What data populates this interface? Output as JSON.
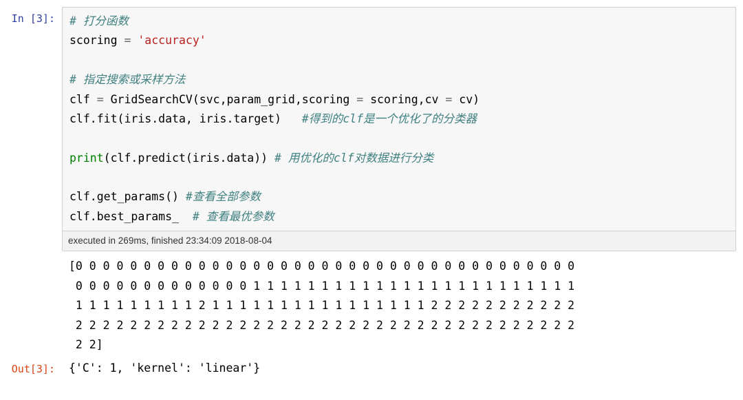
{
  "in_prompt": "In  [3]:",
  "out_prompt": "Out[3]:",
  "code": {
    "l1_comment": "# 打分函数",
    "l2_pre": "scoring ",
    "l2_op": "=",
    "l2_str": " 'accuracy'",
    "l3": "",
    "l4_comment": "# 指定搜索或采样方法",
    "l5_pre": "clf ",
    "l5_op": "=",
    "l5_post": " GridSearchCV(svc,param_grid,scoring ",
    "l5_op2": "=",
    "l5_post2": " scoring,cv ",
    "l5_op3": "=",
    "l5_post3": " cv)",
    "l6_pre": "clf.fit(iris.data, iris.target)   ",
    "l6_comment": "#得到的clf是一个优化了的分类器",
    "l7": "",
    "l8_builtin": "print",
    "l8_post": "(clf.predict(iris.data)) ",
    "l8_comment": "# 用优化的clf对数据进行分类",
    "l9": "",
    "l10_pre": "clf.get_params() ",
    "l10_comment": "#查看全部参数",
    "l11_pre": "clf.best_params_  ",
    "l11_comment": "# 查看最优参数"
  },
  "execution_info": "executed in 269ms, finished 23:34:09 2018-08-04",
  "stdout": "[0 0 0 0 0 0 0 0 0 0 0 0 0 0 0 0 0 0 0 0 0 0 0 0 0 0 0 0 0 0 0 0 0 0 0 0 0\n 0 0 0 0 0 0 0 0 0 0 0 0 0 1 1 1 1 1 1 1 1 1 1 1 1 1 1 1 1 1 1 1 1 1 1 1 1\n 1 1 1 1 1 1 1 1 1 2 1 1 1 1 1 1 1 1 1 1 1 1 1 1 1 1 2 2 2 2 2 2 2 2 2 2 2\n 2 2 2 2 2 2 2 2 2 2 2 2 2 2 2 2 2 2 2 2 2 2 2 2 2 2 2 2 2 2 2 2 2 2 2 2 2\n 2 2]",
  "out_result": "{'C': 1, 'kernel': 'linear'}"
}
